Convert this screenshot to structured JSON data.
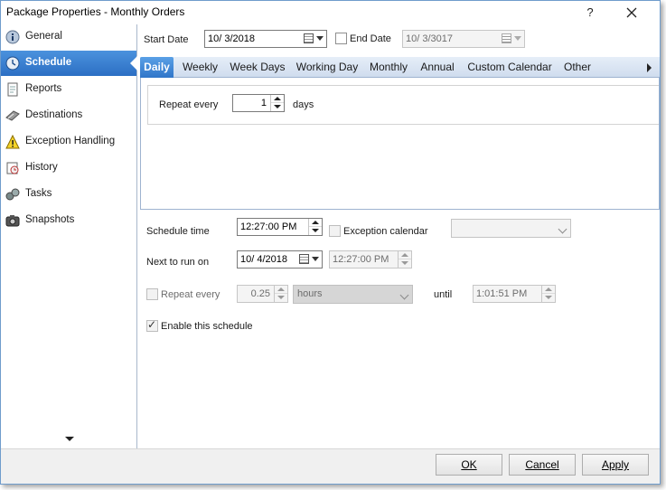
{
  "window": {
    "title": "Package Properties - Monthly Orders",
    "help_label": "?"
  },
  "sidebar": {
    "items": [
      {
        "label": "General",
        "icon": "info-icon"
      },
      {
        "label": "Schedule",
        "icon": "clock-icon"
      },
      {
        "label": "Reports",
        "icon": "report-icon"
      },
      {
        "label": "Destinations",
        "icon": "destinations-icon"
      },
      {
        "label": "Exception Handling",
        "icon": "warning-icon"
      },
      {
        "label": "History",
        "icon": "history-icon"
      },
      {
        "label": "Tasks",
        "icon": "tasks-icon"
      },
      {
        "label": "Snapshots",
        "icon": "camera-icon"
      }
    ],
    "active_index": 1
  },
  "schedule": {
    "start_date_label": "Start Date",
    "start_date": "10/  3/2018",
    "end_date_label": "End Date",
    "end_date": "10/  3/3017",
    "tabs": [
      "Daily",
      "Weekly",
      "Week Days",
      "Working Day",
      "Monthly",
      "Annual",
      "Custom Calendar",
      "Other"
    ],
    "active_tab": "Daily",
    "repeat_every_label": "Repeat every",
    "repeat_every_value": "1",
    "repeat_every_unit": "days",
    "schedule_time_label": "Schedule time",
    "schedule_time": "12:27:00 PM",
    "exception_calendar_label": "Exception calendar",
    "exception_calendar_value": "",
    "next_run_label": "Next to run on",
    "next_run_date": "10/  4/2018",
    "next_run_time": "12:27:00 PM",
    "repeat_label": "Repeat every",
    "repeat_value": "0.25",
    "repeat_unit": "hours",
    "until_label": "until",
    "until_time": "1:01:51 PM",
    "enable_label": "Enable this schedule",
    "enable_checked": true
  },
  "footer": {
    "ok": "OK",
    "cancel": "Cancel",
    "apply": "Apply"
  },
  "colors": {
    "accent": "#2f75c9",
    "active_nav": "#3a82d4",
    "tabbar": "#d6e2f1"
  }
}
